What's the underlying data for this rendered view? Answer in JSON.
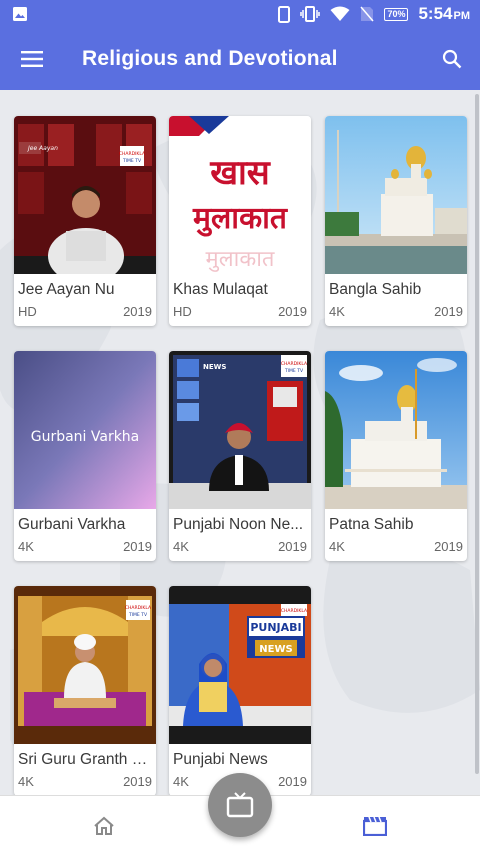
{
  "status_bar": {
    "time": "5:54",
    "ampm": "PM",
    "battery": "70%"
  },
  "app_bar": {
    "title": "Religious and Devotional"
  },
  "cards": [
    {
      "title": "Jee Aayan Nu",
      "quality": "HD",
      "year": "2019",
      "thumb_text": "",
      "channel": "CHARDIKLA TIME TV"
    },
    {
      "title": "Khas Mulaqat",
      "quality": "HD",
      "year": "2019",
      "thumb_text": "खास मुलाकात",
      "channel": ""
    },
    {
      "title": "Bangla Sahib",
      "quality": "4K",
      "year": "2019",
      "thumb_text": "",
      "channel": ""
    },
    {
      "title": "Gurbani Varkha",
      "quality": "4K",
      "year": "2019",
      "thumb_text": "Gurbani Varkha",
      "channel": ""
    },
    {
      "title": "Punjabi Noon Ne...",
      "quality": "4K",
      "year": "2019",
      "thumb_text": "NEWS",
      "channel": "CHARDIKLA TIME TV"
    },
    {
      "title": "Patna Sahib",
      "quality": "4K",
      "year": "2019",
      "thumb_text": "",
      "channel": ""
    },
    {
      "title": "Sri Guru Granth S...",
      "quality": "4K",
      "year": "2019",
      "thumb_text": "",
      "channel": "CHARDIKLA TIME TV"
    },
    {
      "title": "Punjabi News",
      "quality": "4K",
      "year": "2019",
      "thumb_text": "PUNJABI NEWS",
      "channel": "CHARDIKLA TIME TV"
    }
  ],
  "icons": {
    "menu": "menu-icon",
    "search": "search-icon",
    "home": "home-icon",
    "tv": "tv-icon",
    "movies": "movie-clapper-icon"
  },
  "colors": {
    "primary": "#5a6fe0",
    "active_nav": "#4a5fd6",
    "fab": "#8c8c8c"
  }
}
